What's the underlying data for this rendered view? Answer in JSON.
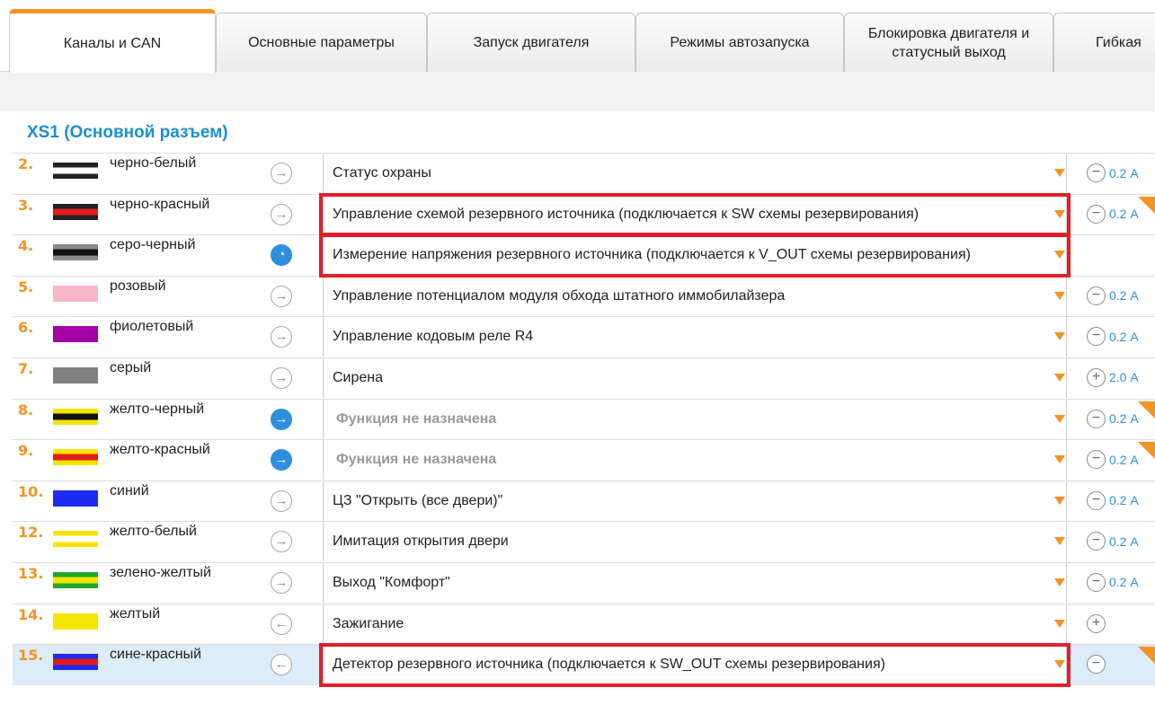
{
  "tabs": [
    {
      "label": "Каналы и CAN",
      "active": true
    },
    {
      "label": "Основные параметры",
      "active": false
    },
    {
      "label": "Запуск двигателя",
      "active": false
    },
    {
      "label": "Режимы автозапуска",
      "active": false
    },
    {
      "label_line1": "Блокировка двигателя и",
      "label_line2": "статусный выход",
      "active": false
    },
    {
      "label": "Гибкая",
      "active": false
    }
  ],
  "section_title": "XS1 (Основной разъем)",
  "colors": {
    "accent": "#f39421",
    "link_blue": "#2e8fde",
    "highlight_red": "#e01f2a",
    "selected_row": "#dcecf8"
  },
  "rows": [
    {
      "num": "2.",
      "wire": "черно-белый",
      "colors": [
        "#222222",
        "#ffffff"
      ],
      "direction": "out",
      "dir_style": "plain",
      "dir_icon": "arrow-right-icon",
      "function": "Статус охраны",
      "muted": false,
      "cur_btn": "−",
      "current": "0.2 А",
      "corner": false,
      "highlight": false
    },
    {
      "num": "3.",
      "wire": "черно-красный",
      "colors": [
        "#222222",
        "#e31b1b"
      ],
      "direction": "out",
      "dir_style": "plain",
      "dir_icon": "arrow-right-icon",
      "function": "Управление схемой резервного источника (подключается к SW схемы резервирования)",
      "muted": false,
      "cur_btn": "−",
      "current": "0.2 А",
      "corner": true,
      "highlight": true
    },
    {
      "num": "4.",
      "wire": "серо-черный",
      "colors": [
        "#8a8a8a",
        "#111111"
      ],
      "direction": "measure",
      "dir_style": "blue",
      "dir_icon": "gauge-icon",
      "function": "Измерение напряжения резервного источника (подключается к V_OUT схемы резервирования)",
      "muted": false,
      "cur_btn": "",
      "current": "",
      "corner": false,
      "highlight": true
    },
    {
      "num": "5.",
      "wire": "розовый",
      "colors": [
        "#f6b8c8",
        "#f6b8c8"
      ],
      "direction": "out",
      "dir_style": "plain",
      "dir_icon": "arrow-right-icon",
      "function": "Управление потенциалом модуля обхода штатного иммобилайзера",
      "muted": false,
      "cur_btn": "−",
      "current": "0.2 А",
      "corner": false,
      "highlight": false
    },
    {
      "num": "6.",
      "wire": "фиолетовый",
      "colors": [
        "#a400a6",
        "#a400a6"
      ],
      "direction": "out",
      "dir_style": "plain",
      "dir_icon": "arrow-right-icon",
      "function": "Управление кодовым реле R4",
      "muted": false,
      "cur_btn": "−",
      "current": "0.2 А",
      "corner": false,
      "highlight": false
    },
    {
      "num": "7.",
      "wire": "серый",
      "colors": [
        "#808080",
        "#808080"
      ],
      "direction": "out",
      "dir_style": "plain",
      "dir_icon": "arrow-right-icon",
      "function": "Сирена",
      "muted": false,
      "cur_btn": "+",
      "current": "2.0 А",
      "corner": false,
      "highlight": false
    },
    {
      "num": "8.",
      "wire": "желто-черный",
      "colors": [
        "#f5e600",
        "#111111"
      ],
      "direction": "out",
      "dir_style": "blue",
      "dir_icon": "arrow-right-icon",
      "function": "Функция не назначена",
      "muted": true,
      "cur_btn": "−",
      "current": "0.2 А",
      "corner": true,
      "highlight": false
    },
    {
      "num": "9.",
      "wire": "желто-красный",
      "colors": [
        "#f5e600",
        "#e31b1b"
      ],
      "direction": "out",
      "dir_style": "blue",
      "dir_icon": "arrow-right-icon",
      "function": "Функция не назначена",
      "muted": true,
      "cur_btn": "−",
      "current": "0.2 А",
      "corner": true,
      "highlight": false
    },
    {
      "num": "10.",
      "wire": "синий",
      "colors": [
        "#1d2cf0",
        "#1d2cf0"
      ],
      "direction": "out",
      "dir_style": "plain",
      "dir_icon": "arrow-right-icon",
      "function": "ЦЗ \"Открыть (все двери)\"",
      "muted": false,
      "cur_btn": "−",
      "current": "0.2 А",
      "corner": false,
      "highlight": false
    },
    {
      "num": "12.",
      "wire": "желто-белый",
      "colors": [
        "#f5e600",
        "#ffffff"
      ],
      "direction": "out",
      "dir_style": "plain",
      "dir_icon": "arrow-right-icon",
      "function": "Имитация открытия двери",
      "muted": false,
      "cur_btn": "−",
      "current": "0.2 А",
      "corner": false,
      "highlight": false
    },
    {
      "num": "13.",
      "wire": "зелено-желтый",
      "colors": [
        "#1fa82a",
        "#f5e600"
      ],
      "direction": "out",
      "dir_style": "plain",
      "dir_icon": "arrow-right-icon",
      "function": "Выход \"Комфорт\"",
      "muted": false,
      "cur_btn": "−",
      "current": "0.2 А",
      "corner": false,
      "highlight": false
    },
    {
      "num": "14.",
      "wire": "желтый",
      "colors": [
        "#f5e600",
        "#f5e600"
      ],
      "direction": "in",
      "dir_style": "plain",
      "dir_icon": "arrow-left-icon",
      "function": "Зажигание",
      "muted": false,
      "cur_btn": "+",
      "current": "",
      "corner": false,
      "highlight": false
    },
    {
      "num": "15.",
      "wire": "сине-красный",
      "colors": [
        "#1d2cf0",
        "#e31b1b"
      ],
      "direction": "in",
      "dir_style": "plain",
      "dir_icon": "arrow-left-icon",
      "function": "Детектор резервного источника (подключается к SW_OUT схемы резервирования)",
      "muted": false,
      "cur_btn": "−",
      "current": "",
      "corner": true,
      "highlight": true,
      "selected": true
    }
  ]
}
